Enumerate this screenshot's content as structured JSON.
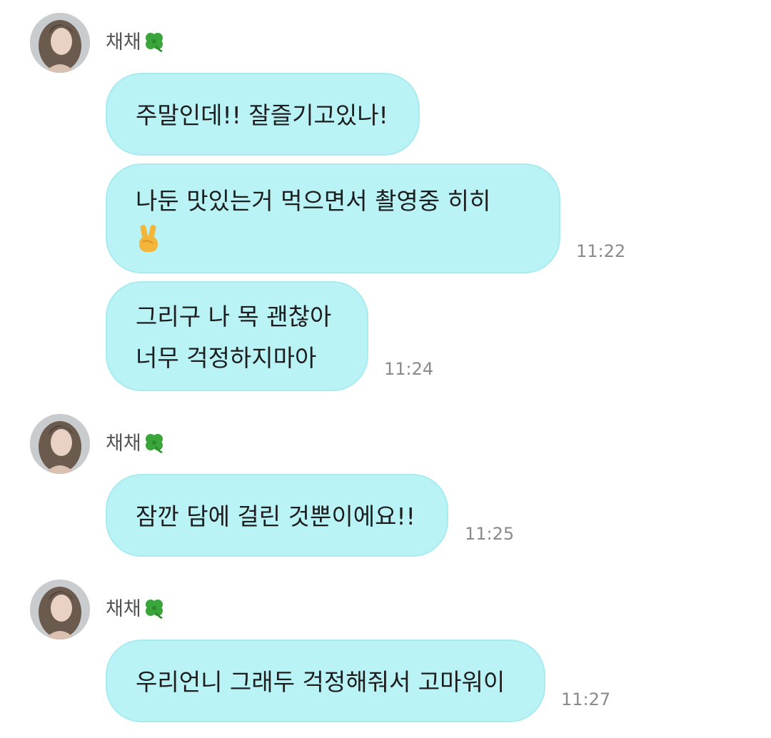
{
  "chat": {
    "groups": [
      {
        "sender": "채채",
        "sender_emoji": "clover",
        "messages": [
          {
            "lines": [
              "주말인데!! 잘즐기고있나!"
            ],
            "time": ""
          },
          {
            "lines": [
              "나둔 맛있는거 먹으면서 촬영중 히히"
            ],
            "emoji": "victory-hand",
            "time": "11:22"
          },
          {
            "lines": [
              "그리구 나 목 괜찮아",
              "너무 걱정하지마아"
            ],
            "time": "11:24"
          }
        ]
      },
      {
        "sender": "채채",
        "sender_emoji": "clover",
        "messages": [
          {
            "lines": [
              "잠깐 담에 걸린 것뿐이에요!!"
            ],
            "time": "11:25"
          }
        ]
      },
      {
        "sender": "채채",
        "sender_emoji": "clover",
        "messages": [
          {
            "lines": [
              "우리언니 그래두 걱정해줘서 고마워이"
            ],
            "time": "11:27"
          }
        ]
      }
    ]
  },
  "colors": {
    "bubble": "#b9f3f6",
    "bubble_border": "#a8ebf0",
    "timestamp": "#8a8a8a",
    "sender": "#555555"
  }
}
